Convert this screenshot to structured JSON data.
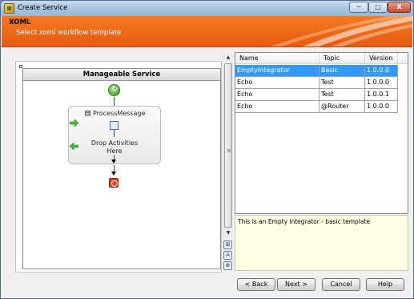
{
  "window": {
    "title": "Create Service",
    "min_glyph": "─",
    "max_glyph": "□",
    "close_glyph": "X"
  },
  "banner": {
    "title": "XOML",
    "subtitle": "Select xoml workflow template"
  },
  "designer": {
    "frame_title": "Manageable Service",
    "activity_title": "ProcessMessage",
    "drop_label_1": "Drop Activities",
    "drop_label_2": "Here",
    "expand_glyph": "⊟",
    "icons": [
      "workflow-start-icon",
      "workflow-end-icon",
      "green-arrow-icon"
    ]
  },
  "scroll": {
    "up": "▲",
    "down": "▼",
    "grip": "≡"
  },
  "tools": {
    "t1": "⊞",
    "t2": "A",
    "t3": "⊕"
  },
  "grid": {
    "headers": {
      "name": "Name",
      "topic": "Topic",
      "version": "Version"
    },
    "rows": [
      {
        "name": "EmptyIntegrator",
        "topic": "Basic",
        "version": "1.0.0.0"
      },
      {
        "name": "Echo",
        "topic": "Test",
        "version": "1.0.0.0"
      },
      {
        "name": "Echo",
        "topic": "Test",
        "version": "1.0.0.1"
      },
      {
        "name": "Echo",
        "topic": "@Router",
        "version": "1.0.0.0"
      }
    ]
  },
  "description": "This is an Empty integrator - basic template",
  "buttons": {
    "back": "< Back",
    "next": "Next >",
    "cancel": "Cancel",
    "help": "Help"
  },
  "colors": {
    "banner": "#f06a1a",
    "selection": "#3399ff",
    "description_bg": "#ffffe4"
  }
}
